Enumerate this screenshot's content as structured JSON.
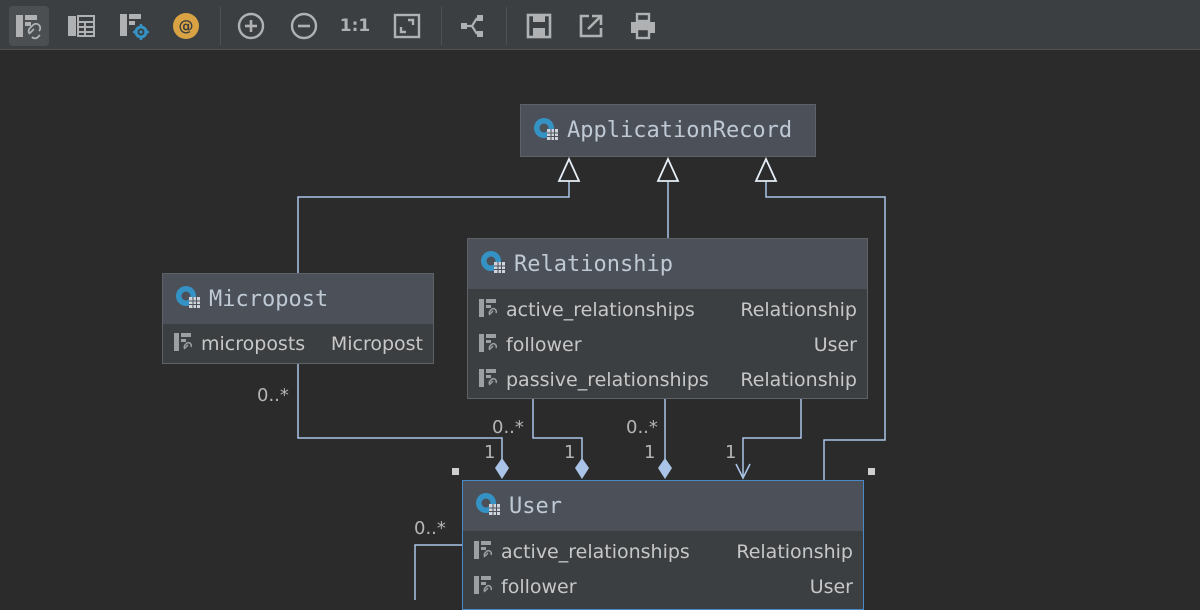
{
  "toolbar": {
    "buttons": [
      {
        "icon": "show-associations-icon",
        "active": true
      },
      {
        "icon": "show-fields-icon"
      },
      {
        "icon": "settings-diagram-icon"
      },
      {
        "icon": "annotations-icon",
        "text": "@"
      },
      {
        "icon": "zoom-in-icon"
      },
      {
        "icon": "zoom-out-icon"
      },
      {
        "icon": "actual-size-icon",
        "text": "1:1"
      },
      {
        "icon": "fit-content-icon"
      },
      {
        "icon": "layout-icon"
      },
      {
        "icon": "save-icon"
      },
      {
        "icon": "export-icon"
      },
      {
        "icon": "print-icon"
      }
    ]
  },
  "diagram": {
    "nodes": {
      "application_record": {
        "title": "ApplicationRecord"
      },
      "micropost": {
        "title": "Micropost",
        "fields": [
          {
            "name": "microposts",
            "type": "Micropost"
          }
        ]
      },
      "relationship": {
        "title": "Relationship",
        "fields": [
          {
            "name": "active_relationships",
            "type": "Relationship"
          },
          {
            "name": "follower",
            "type": "User"
          },
          {
            "name": "passive_relationships",
            "type": "Relationship"
          }
        ]
      },
      "user": {
        "title": "User",
        "fields": [
          {
            "name": "active_relationships",
            "type": "Relationship"
          },
          {
            "name": "follower",
            "type": "User"
          }
        ]
      }
    },
    "multiplicities": {
      "micropost_many": "0..*",
      "micropost_one": "1",
      "rel_many_left": "0..*",
      "rel_one_left": "1",
      "rel_many_right": "0..*",
      "rel_one_right": "1",
      "rel_one_far": "1",
      "user_many": "0..*"
    }
  },
  "colors": {
    "background": "#2b2b2b",
    "toolbar": "#3c3f41",
    "node_header": "#4b5059",
    "node_body": "#3c3f41",
    "edge": "#a9c4e6",
    "selection": "#4a88c7",
    "ruby_class_icon": "#3592c4",
    "annotation_icon": "#d9a343"
  }
}
